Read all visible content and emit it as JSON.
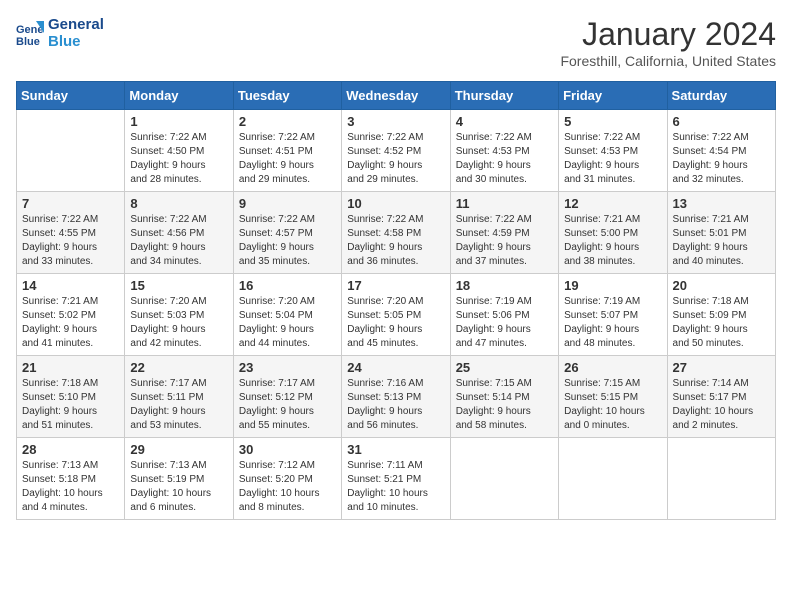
{
  "header": {
    "logo_line1": "General",
    "logo_line2": "Blue",
    "month_title": "January 2024",
    "location": "Foresthill, California, United States"
  },
  "days_of_week": [
    "Sunday",
    "Monday",
    "Tuesday",
    "Wednesday",
    "Thursday",
    "Friday",
    "Saturday"
  ],
  "weeks": [
    [
      {
        "day": "",
        "info": ""
      },
      {
        "day": "1",
        "info": "Sunrise: 7:22 AM\nSunset: 4:50 PM\nDaylight: 9 hours\nand 28 minutes."
      },
      {
        "day": "2",
        "info": "Sunrise: 7:22 AM\nSunset: 4:51 PM\nDaylight: 9 hours\nand 29 minutes."
      },
      {
        "day": "3",
        "info": "Sunrise: 7:22 AM\nSunset: 4:52 PM\nDaylight: 9 hours\nand 29 minutes."
      },
      {
        "day": "4",
        "info": "Sunrise: 7:22 AM\nSunset: 4:53 PM\nDaylight: 9 hours\nand 30 minutes."
      },
      {
        "day": "5",
        "info": "Sunrise: 7:22 AM\nSunset: 4:53 PM\nDaylight: 9 hours\nand 31 minutes."
      },
      {
        "day": "6",
        "info": "Sunrise: 7:22 AM\nSunset: 4:54 PM\nDaylight: 9 hours\nand 32 minutes."
      }
    ],
    [
      {
        "day": "7",
        "info": "Sunrise: 7:22 AM\nSunset: 4:55 PM\nDaylight: 9 hours\nand 33 minutes."
      },
      {
        "day": "8",
        "info": "Sunrise: 7:22 AM\nSunset: 4:56 PM\nDaylight: 9 hours\nand 34 minutes."
      },
      {
        "day": "9",
        "info": "Sunrise: 7:22 AM\nSunset: 4:57 PM\nDaylight: 9 hours\nand 35 minutes."
      },
      {
        "day": "10",
        "info": "Sunrise: 7:22 AM\nSunset: 4:58 PM\nDaylight: 9 hours\nand 36 minutes."
      },
      {
        "day": "11",
        "info": "Sunrise: 7:22 AM\nSunset: 4:59 PM\nDaylight: 9 hours\nand 37 minutes."
      },
      {
        "day": "12",
        "info": "Sunrise: 7:21 AM\nSunset: 5:00 PM\nDaylight: 9 hours\nand 38 minutes."
      },
      {
        "day": "13",
        "info": "Sunrise: 7:21 AM\nSunset: 5:01 PM\nDaylight: 9 hours\nand 40 minutes."
      }
    ],
    [
      {
        "day": "14",
        "info": "Sunrise: 7:21 AM\nSunset: 5:02 PM\nDaylight: 9 hours\nand 41 minutes."
      },
      {
        "day": "15",
        "info": "Sunrise: 7:20 AM\nSunset: 5:03 PM\nDaylight: 9 hours\nand 42 minutes."
      },
      {
        "day": "16",
        "info": "Sunrise: 7:20 AM\nSunset: 5:04 PM\nDaylight: 9 hours\nand 44 minutes."
      },
      {
        "day": "17",
        "info": "Sunrise: 7:20 AM\nSunset: 5:05 PM\nDaylight: 9 hours\nand 45 minutes."
      },
      {
        "day": "18",
        "info": "Sunrise: 7:19 AM\nSunset: 5:06 PM\nDaylight: 9 hours\nand 47 minutes."
      },
      {
        "day": "19",
        "info": "Sunrise: 7:19 AM\nSunset: 5:07 PM\nDaylight: 9 hours\nand 48 minutes."
      },
      {
        "day": "20",
        "info": "Sunrise: 7:18 AM\nSunset: 5:09 PM\nDaylight: 9 hours\nand 50 minutes."
      }
    ],
    [
      {
        "day": "21",
        "info": "Sunrise: 7:18 AM\nSunset: 5:10 PM\nDaylight: 9 hours\nand 51 minutes."
      },
      {
        "day": "22",
        "info": "Sunrise: 7:17 AM\nSunset: 5:11 PM\nDaylight: 9 hours\nand 53 minutes."
      },
      {
        "day": "23",
        "info": "Sunrise: 7:17 AM\nSunset: 5:12 PM\nDaylight: 9 hours\nand 55 minutes."
      },
      {
        "day": "24",
        "info": "Sunrise: 7:16 AM\nSunset: 5:13 PM\nDaylight: 9 hours\nand 56 minutes."
      },
      {
        "day": "25",
        "info": "Sunrise: 7:15 AM\nSunset: 5:14 PM\nDaylight: 9 hours\nand 58 minutes."
      },
      {
        "day": "26",
        "info": "Sunrise: 7:15 AM\nSunset: 5:15 PM\nDaylight: 10 hours\nand 0 minutes."
      },
      {
        "day": "27",
        "info": "Sunrise: 7:14 AM\nSunset: 5:17 PM\nDaylight: 10 hours\nand 2 minutes."
      }
    ],
    [
      {
        "day": "28",
        "info": "Sunrise: 7:13 AM\nSunset: 5:18 PM\nDaylight: 10 hours\nand 4 minutes."
      },
      {
        "day": "29",
        "info": "Sunrise: 7:13 AM\nSunset: 5:19 PM\nDaylight: 10 hours\nand 6 minutes."
      },
      {
        "day": "30",
        "info": "Sunrise: 7:12 AM\nSunset: 5:20 PM\nDaylight: 10 hours\nand 8 minutes."
      },
      {
        "day": "31",
        "info": "Sunrise: 7:11 AM\nSunset: 5:21 PM\nDaylight: 10 hours\nand 10 minutes."
      },
      {
        "day": "",
        "info": ""
      },
      {
        "day": "",
        "info": ""
      },
      {
        "day": "",
        "info": ""
      }
    ]
  ]
}
